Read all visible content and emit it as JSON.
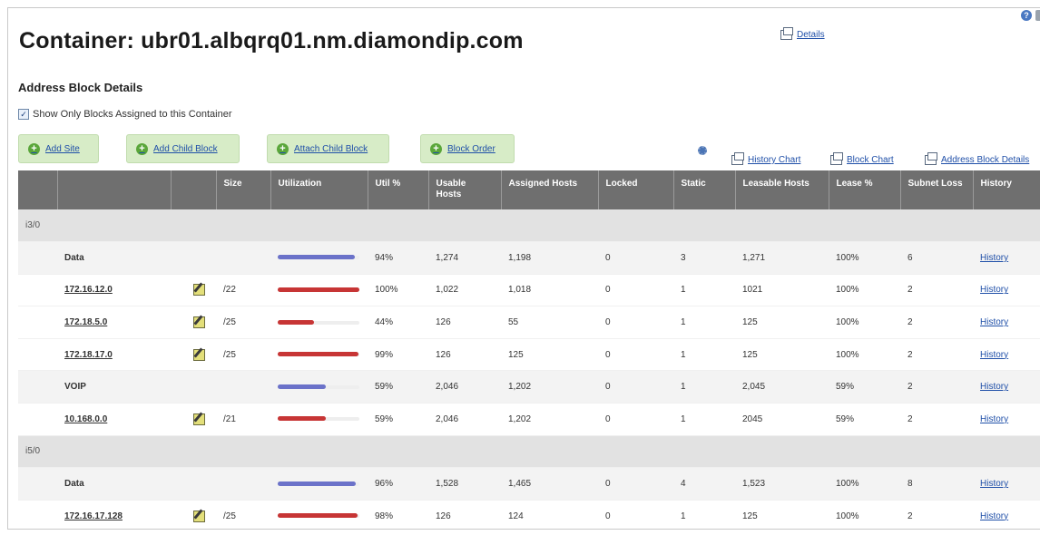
{
  "page_title": "Container: ubr01.albqrq01.nm.diamondip.com",
  "details_link": "Details",
  "section_title": "Address Block Details",
  "show_only_checkbox": {
    "label": "Show Only Blocks Assigned to this Container",
    "checked": true,
    "mark": "✓"
  },
  "toolbar": {
    "add_site": "Add Site",
    "add_child_block": "Add Child Block",
    "attach_child_block": "Attach Child Block",
    "block_order": "Block Order",
    "history_chart": "History Chart",
    "block_chart": "Block Chart",
    "address_block_details": "Address Block Details"
  },
  "icons": {
    "help": "?"
  },
  "columns": [
    "Size",
    "Utilization",
    "Util %",
    "Usable Hosts",
    "Assigned Hosts",
    "Locked",
    "Static",
    "Leasable Hosts",
    "Lease %",
    "Subnet Loss",
    "History"
  ],
  "rows": [
    {
      "kind": "group",
      "label": "i3/0"
    },
    {
      "kind": "agg",
      "name": "Data",
      "util": 0.94,
      "bar": "blue",
      "util_pct": "94%",
      "usable": "1,274",
      "assigned": "1,198",
      "locked": "0",
      "static": "3",
      "leasable": "1,271",
      "lease_pct": "100%",
      "subnet_loss": "6",
      "history": "History"
    },
    {
      "kind": "block",
      "name": "172.16.12.0",
      "size": "/22",
      "util": 1.0,
      "bar": "red",
      "util_pct": "100%",
      "usable": "1,022",
      "assigned": "1,018",
      "locked": "0",
      "static": "1",
      "leasable": "1021",
      "lease_pct": "100%",
      "subnet_loss": "2",
      "history": "History"
    },
    {
      "kind": "block",
      "name": "172.18.5.0",
      "size": "/25",
      "util": 0.44,
      "bar": "red",
      "util_pct": "44%",
      "usable": "126",
      "assigned": "55",
      "locked": "0",
      "static": "1",
      "leasable": "125",
      "lease_pct": "100%",
      "subnet_loss": "2",
      "history": "History"
    },
    {
      "kind": "block",
      "name": "172.18.17.0",
      "size": "/25",
      "util": 0.99,
      "bar": "red",
      "util_pct": "99%",
      "usable": "126",
      "assigned": "125",
      "locked": "0",
      "static": "1",
      "leasable": "125",
      "lease_pct": "100%",
      "subnet_loss": "2",
      "history": "History"
    },
    {
      "kind": "agg",
      "name": "VOIP",
      "util": 0.59,
      "bar": "blue",
      "util_pct": "59%",
      "usable": "2,046",
      "assigned": "1,202",
      "locked": "0",
      "static": "1",
      "leasable": "2,045",
      "lease_pct": "59%",
      "subnet_loss": "2",
      "history": "History"
    },
    {
      "kind": "block",
      "name": "10.168.0.0",
      "size": "/21",
      "util": 0.59,
      "bar": "red",
      "util_pct": "59%",
      "usable": "2,046",
      "assigned": "1,202",
      "locked": "0",
      "static": "1",
      "leasable": "2045",
      "lease_pct": "59%",
      "subnet_loss": "2",
      "history": "History"
    },
    {
      "kind": "group",
      "label": "i5/0"
    },
    {
      "kind": "agg",
      "name": "Data",
      "util": 0.96,
      "bar": "blue",
      "util_pct": "96%",
      "usable": "1,528",
      "assigned": "1,465",
      "locked": "0",
      "static": "4",
      "leasable": "1,523",
      "lease_pct": "100%",
      "subnet_loss": "8",
      "history": "History"
    },
    {
      "kind": "block",
      "name": "172.16.17.128",
      "size": "/25",
      "util": 0.98,
      "bar": "red",
      "util_pct": "98%",
      "usable": "126",
      "assigned": "124",
      "locked": "0",
      "static": "1",
      "leasable": "125",
      "lease_pct": "100%",
      "subnet_loss": "2",
      "history": "History"
    }
  ]
}
